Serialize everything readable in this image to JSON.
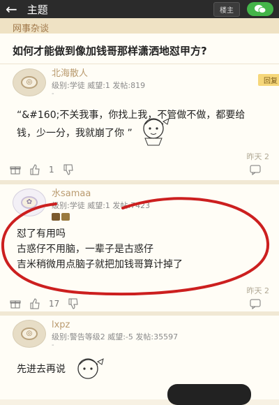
{
  "topbar": {
    "back_icon": "←",
    "title": "主题",
    "op_label": "楼主",
    "share_icon": "wechat-icon"
  },
  "section": {
    "name": "网事杂谈"
  },
  "thread": {
    "title": "如何才能做到像加钱哥那样潇洒地怼甲方?"
  },
  "posts": [
    {
      "username": "北海散人",
      "level": "级别:学徒 威望:1 发帖:819",
      "dash": "-",
      "floor_tag": "回复",
      "body": [
        "“&#160;不关我事，你找上我，不管做不做，都要给",
        "钱，少一分，我就崩了你 ”"
      ],
      "time": "昨天 2",
      "likes": "1"
    },
    {
      "username": "水samaa",
      "level": "级别:学徒 威望:1 发帖:7423",
      "body": [
        "怼了有用吗",
        "古惑仔不用脑，一辈子是古惑仔",
        "吉米稍微用点脑子就把加钱哥算计掉了"
      ],
      "time": "昨天 2",
      "likes": "17"
    },
    {
      "username": "lxpz",
      "level": "级别:警告等级2 威望:-5 发帖:35597",
      "dash": "-",
      "body": [
        "先进去再说"
      ]
    }
  ]
}
